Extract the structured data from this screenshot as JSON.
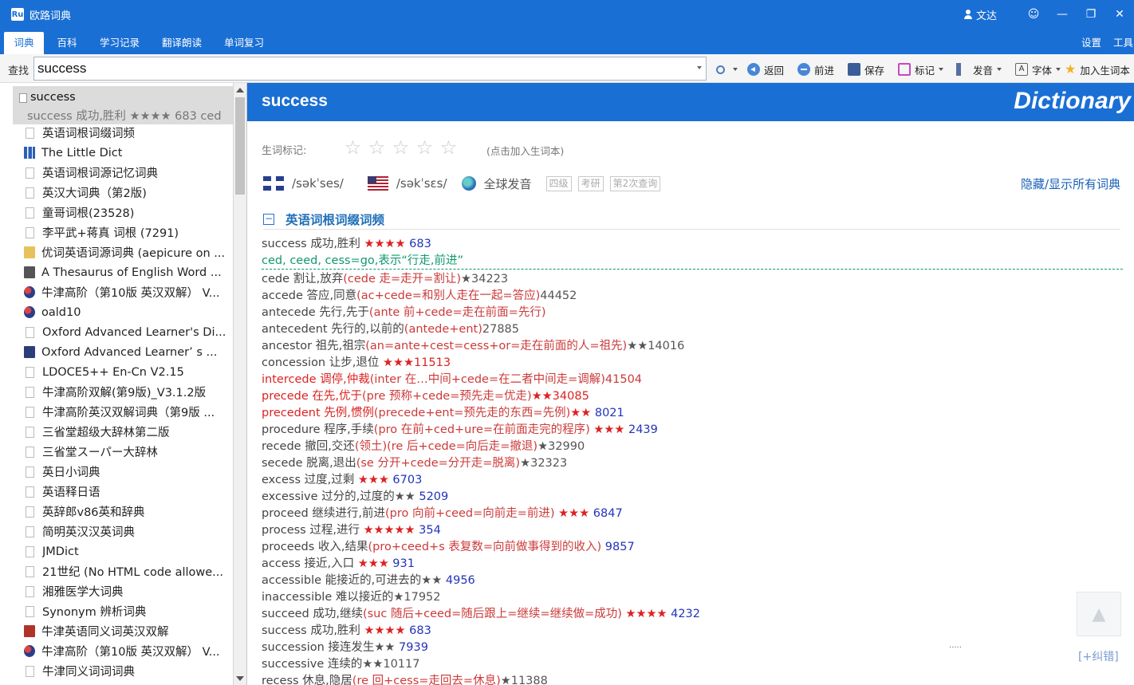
{
  "window": {
    "title": "欧路词典",
    "user": "文达",
    "emoji_icon": "smiley-icon",
    "controls": [
      "—",
      "❐",
      "✕"
    ]
  },
  "menu": {
    "tabs": [
      "词典",
      "百科",
      "学习记录",
      "翻译朗读",
      "单词复习"
    ],
    "active": "词典",
    "right": [
      "设置",
      "工具"
    ]
  },
  "toolbar": {
    "find_label": "查找",
    "search_value": "success",
    "back": "返回",
    "forward": "前进",
    "save": "保存",
    "mark": "标记",
    "pronounce": "发音",
    "font": "字体",
    "add_word": "加入生词本"
  },
  "sidebar": {
    "selected_word": "success",
    "selected_sub": "success 成功,胜利 ★★★★  683  ced",
    "items": [
      {
        "label": "英语词根词缀词频",
        "icon": "doc"
      },
      {
        "label": "The Little Dict",
        "icon": "chart"
      },
      {
        "label": "英语词根词源记忆词典",
        "icon": "doc"
      },
      {
        "label": "英汉大词典（第2版)",
        "icon": "doc"
      },
      {
        "label": "童哥词根(23528)",
        "icon": "doc"
      },
      {
        "label": "李平武+蒋真 词根 (7291)",
        "icon": "doc"
      },
      {
        "label": "优词英语词源词典 (aepicure on ...",
        "icon": "yellow"
      },
      {
        "label": "A Thesaurus of English Word ...",
        "icon": "thes"
      },
      {
        "label": "牛津高阶（第10版 英汉双解） V...",
        "icon": "globe"
      },
      {
        "label": "oald10",
        "icon": "globe"
      },
      {
        "label": "Oxford Advanced Learner's Di...",
        "icon": "doc"
      },
      {
        "label": "Oxford Advanced Learner’ s ...",
        "icon": "book"
      },
      {
        "label": "LDOCE5++ En-Cn V2.15",
        "icon": "doc"
      },
      {
        "label": "牛津高阶双解(第9版)_V3.1.2版",
        "icon": "doc"
      },
      {
        "label": "牛津高阶英汉双解词典（第9版 ...",
        "icon": "doc"
      },
      {
        "label": "三省堂超级大辞林第二版",
        "icon": "doc"
      },
      {
        "label": "三省堂スーパー大辞林",
        "icon": "doc"
      },
      {
        "label": "英日小词典",
        "icon": "doc"
      },
      {
        "label": "英语释日语",
        "icon": "doc"
      },
      {
        "label": "英辞郎v86英和辞典",
        "icon": "doc"
      },
      {
        "label": "简明英汉汉英词典",
        "icon": "doc"
      },
      {
        "label": "JMDict",
        "icon": "doc"
      },
      {
        "label": "21世纪 (No HTML code allowe...",
        "icon": "doc"
      },
      {
        "label": "湘雅医学大词典",
        "icon": "doc"
      },
      {
        "label": "Synonym 辨析词典",
        "icon": "doc"
      },
      {
        "label": "牛津英语同义词英汉双解",
        "icon": "redbook"
      },
      {
        "label": "牛津高阶（第10版 英汉双解） V...",
        "icon": "globe"
      },
      {
        "label": "牛津同义词词词典",
        "icon": "doc"
      }
    ]
  },
  "content": {
    "headword": "success",
    "brand": "Dictionary",
    "rating_label": "生词标记:",
    "rating_hint": "(点击加入生词本)",
    "uk_phonetic": "/səkˈses/",
    "us_phonetic": "/səkˈsɛs/",
    "global_pron": "全球发音",
    "badges": [
      "四级",
      "考研",
      "第2次查询"
    ],
    "toggle_all": "隐藏/显示所有词典",
    "section_title": "英语词根词缀词频",
    "scroll_top_icon": "arrow-up-icon",
    "report": "[+纠错]",
    "entries": [
      {
        "w": "success",
        "m": " 成功,胜利 ",
        "e": "",
        "s": "★★★★",
        "g": "",
        "n": " 683"
      },
      {
        "root": "ced, ceed, cess=go,表示“行走,前进”"
      },
      {
        "w": "cede",
        "m": " 割让,放弃",
        "e": "(cede 走=走开=割让)",
        "s": "",
        "g": "★34223",
        "n": ""
      },
      {
        "w": "accede",
        "m": " 答应,同意",
        "e": "(ac+cede=和别人走在一起=答应)",
        "s": "",
        "g": "44452",
        "n": ""
      },
      {
        "w": "antecede",
        "m": " 先行,先于",
        "e": "(ante 前+cede=走在前面=先行)",
        "s": "",
        "g": "",
        "n": ""
      },
      {
        "w": "antecedent",
        "m": " 先行的,以前的",
        "e": "(antede+ent)",
        "s": "",
        "g": "27885",
        "n": ""
      },
      {
        "w": "ancestor",
        "m": " 祖先,祖宗",
        "e": "(an=ante+cest=cess+or=走在前面的人=祖先)",
        "s": "",
        "g": "★★14016",
        "n": ""
      },
      {
        "w": "concession",
        "m": " 让步,退位 ",
        "e": "",
        "s": "★★★11513",
        "g": "",
        "n": ""
      },
      {
        "w": "intercede",
        "m": " 调停,仲裁",
        "e": "(inter 在…中间+cede=在二者中间走=调解)41504",
        "s": "",
        "g": "",
        "n": "",
        "hl": true
      },
      {
        "w": "precede",
        "m": " 在先,优于",
        "e": "(pre 预称+cede=预先走=优走)",
        "s": "★★34085",
        "g": "",
        "n": "",
        "hl": true
      },
      {
        "w": "precedent",
        "m": " 先例,惯例",
        "e": "(precede+ent=预先走的东西=先例)",
        "s": "★★",
        "g": "",
        "n": " 8021",
        "hl": true
      },
      {
        "w": "procedure",
        "m": " 程序,手续",
        "e": "(pro 在前+ced+ure=在前面走完的程序)",
        "s": " ★★★",
        "g": "",
        "n": " 2439"
      },
      {
        "w": "recede",
        "m": " 撤回,交还",
        "e": "(领土)(re 后+cede=向后走=撤退)",
        "s": "",
        "g": "★32990",
        "n": ""
      },
      {
        "w": "secede",
        "m": " 脱离,退出",
        "e": "(se 分开+cede=分开走=脱离)",
        "s": "",
        "g": "★32323",
        "n": ""
      },
      {
        "w": "excess",
        "m": " 过度,过剩 ",
        "e": "",
        "s": "★★★",
        "g": "",
        "n": " 6703"
      },
      {
        "w": "excessive",
        "m": " 过分的,过度的",
        "e": "",
        "s": "",
        "g": "★★",
        "n": " 5209"
      },
      {
        "w": "proceed",
        "m": " 继续进行,前进",
        "e": "(pro 向前+ceed=向前走=前进)",
        "s": " ★★★",
        "g": "",
        "n": " 6847"
      },
      {
        "w": "process",
        "m": " 过程,进行 ",
        "e": "",
        "s": "★★★★★",
        "g": "",
        "n": " 354"
      },
      {
        "w": "proceeds",
        "m": " 收入,结果",
        "e": "(pro+ceed+s 表复数=向前做事得到的收入)",
        "s": "",
        "g": "",
        "n": " 9857"
      },
      {
        "w": "access",
        "m": " 接近,入口 ",
        "e": "",
        "s": "★★★",
        "g": "",
        "n": " 931"
      },
      {
        "w": "accessible",
        "m": " 能接近的,可进去的",
        "e": "",
        "s": "",
        "g": "★★",
        "n": " 4956"
      },
      {
        "w": "inaccessible",
        "m": " 难以接近的",
        "e": "",
        "s": "",
        "g": "★17952",
        "n": ""
      },
      {
        "w": "succeed",
        "m": " 成功,继续",
        "e": "(suc 随后+ceed=随后跟上=继续=继续做=成功)",
        "s": " ★★★★",
        "g": "",
        "n": " 4232"
      },
      {
        "w": "success",
        "m": " 成功,胜利 ",
        "e": "",
        "s": "★★★★",
        "g": "",
        "n": " 683"
      },
      {
        "w": "succession",
        "m": " 接连发生",
        "e": "",
        "s": "",
        "g": "★★",
        "n": " 7939"
      },
      {
        "w": "successive",
        "m": " 连续的",
        "e": "",
        "s": "",
        "g": "★★10117",
        "n": ""
      },
      {
        "w": "recess",
        "m": " 休息,隐居",
        "e": "(re 回+cess=走回去=休息)",
        "s": "",
        "g": "★11388",
        "n": ""
      }
    ]
  }
}
